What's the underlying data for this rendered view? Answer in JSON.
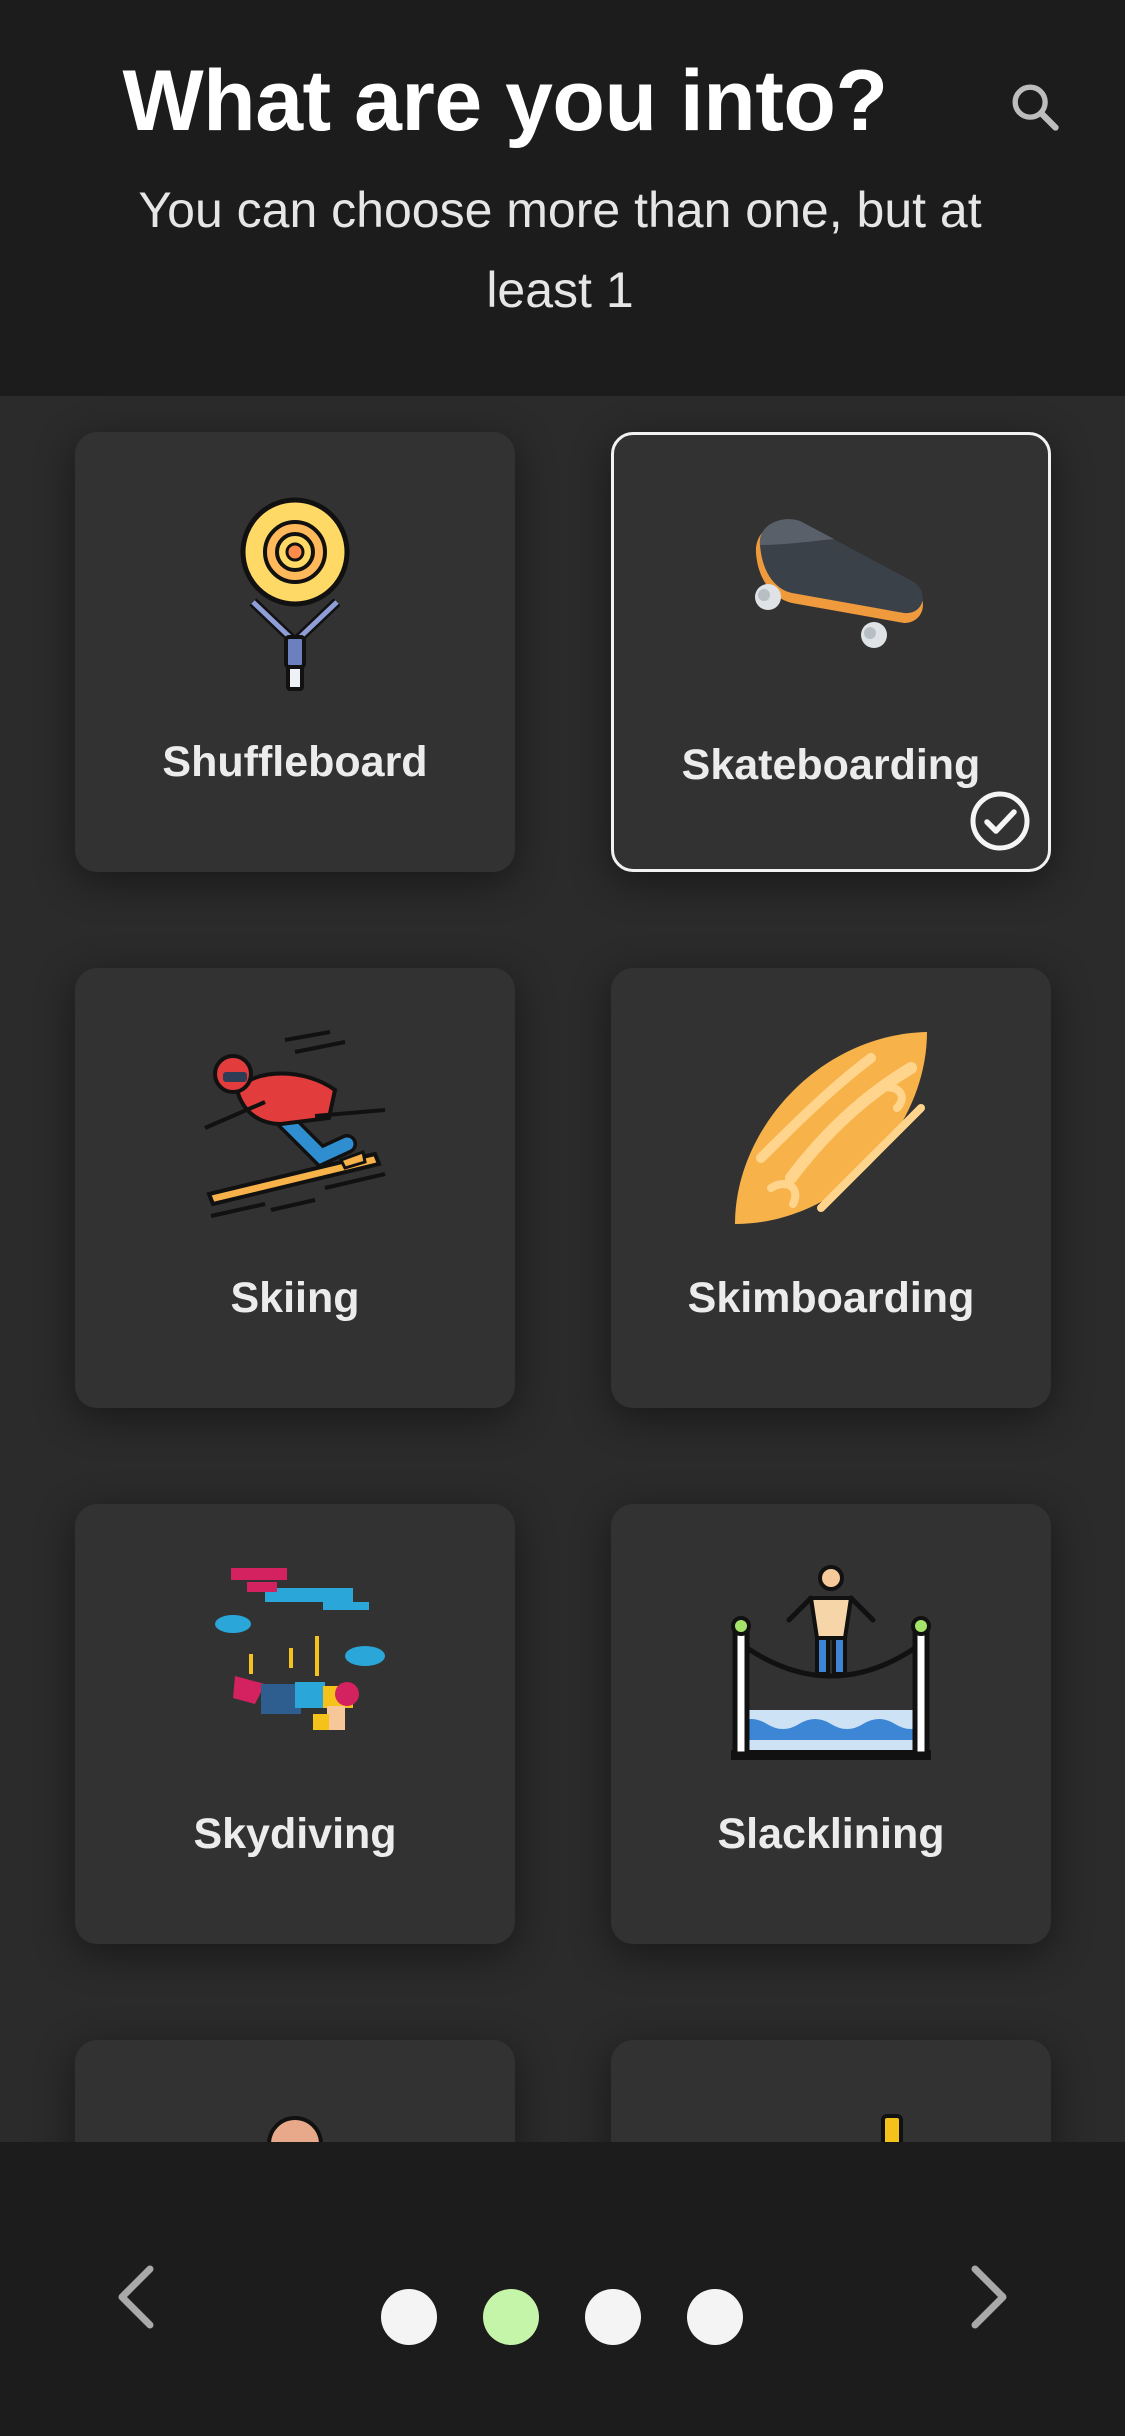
{
  "header": {
    "title": "What are you into?",
    "subtitle": "You can choose more than one, but at least 1",
    "search_icon": "search-icon"
  },
  "activities": [
    {
      "label": "Shuffleboard",
      "icon": "shuffleboard-icon",
      "selected": false
    },
    {
      "label": "Skateboarding",
      "icon": "skateboard-icon",
      "selected": true
    },
    {
      "label": "Skiing",
      "icon": "skier-icon",
      "selected": false
    },
    {
      "label": "Skimboarding",
      "icon": "skimboard-icon",
      "selected": false
    },
    {
      "label": "Skydiving",
      "icon": "skydiver-icon",
      "selected": false
    },
    {
      "label": "Slacklining",
      "icon": "slackline-icon",
      "selected": false
    }
  ],
  "pagination": {
    "pages": 4,
    "current": 2,
    "prev_icon": "chevron-left-icon",
    "next_icon": "chevron-right-icon"
  },
  "colors": {
    "background": "#2b2b2b",
    "header_footer": "#1c1c1c",
    "card": "#323232",
    "active_dot": "#c5f5a8",
    "dot": "#f4f4f4"
  }
}
